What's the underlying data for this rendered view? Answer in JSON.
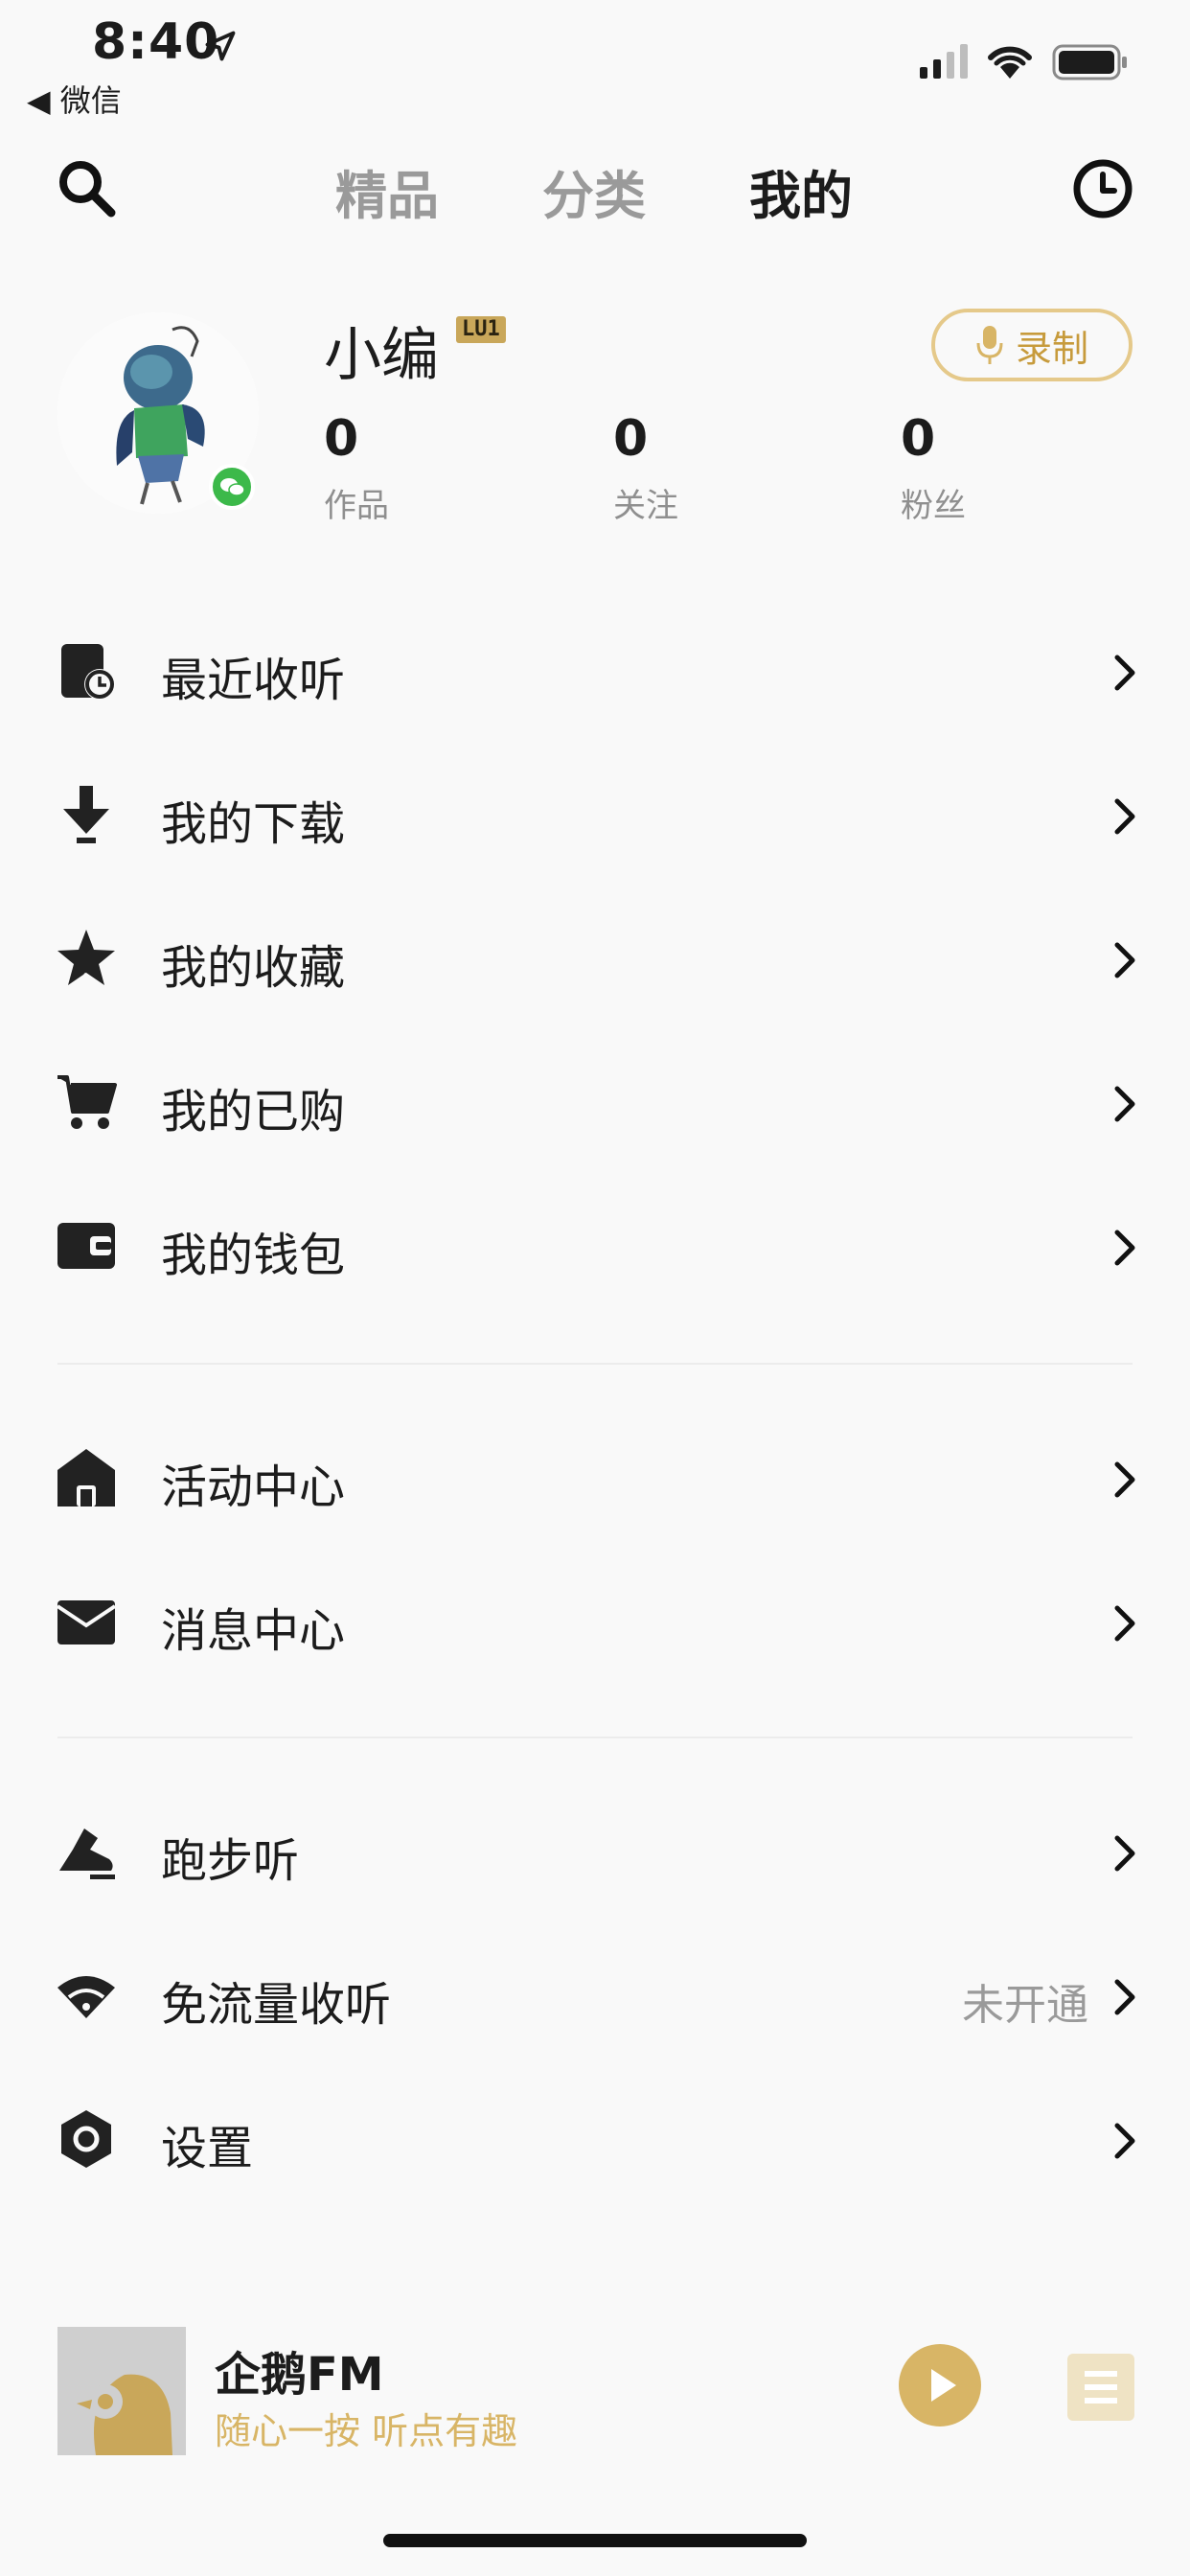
{
  "status_bar": {
    "time": "8:40",
    "back_app": "◀ 微信"
  },
  "nav": {
    "tabs": [
      {
        "label": "精品",
        "active": false
      },
      {
        "label": "分类",
        "active": false
      },
      {
        "label": "我的",
        "active": true
      }
    ]
  },
  "profile": {
    "username": "小编",
    "level": "LU1",
    "record_label": "录制",
    "stats": [
      {
        "value": "0",
        "label": "作品"
      },
      {
        "value": "0",
        "label": "关注"
      },
      {
        "value": "0",
        "label": "粉丝"
      }
    ]
  },
  "menu_groups": [
    [
      {
        "label": "最近收听",
        "icon": "recent-listen-icon"
      },
      {
        "label": "我的下载",
        "icon": "download-icon"
      },
      {
        "label": "我的收藏",
        "icon": "star-icon"
      },
      {
        "label": "我的已购",
        "icon": "cart-icon"
      },
      {
        "label": "我的钱包",
        "icon": "wallet-icon"
      }
    ],
    [
      {
        "label": "活动中心",
        "icon": "activity-center-icon"
      },
      {
        "label": "消息中心",
        "icon": "mail-icon"
      }
    ],
    [
      {
        "label": "跑步听",
        "icon": "running-shoe-icon"
      },
      {
        "label": "免流量收听",
        "icon": "wifi-free-icon",
        "value": "未开通"
      },
      {
        "label": "设置",
        "icon": "settings-icon"
      }
    ]
  ],
  "player": {
    "title": "企鹅FM",
    "subtitle": "随心一按 听点有趣"
  },
  "colors": {
    "accent_gold": "#d8b566",
    "text_dark": "#1c1c1c",
    "text_muted": "#9a9a9a"
  }
}
